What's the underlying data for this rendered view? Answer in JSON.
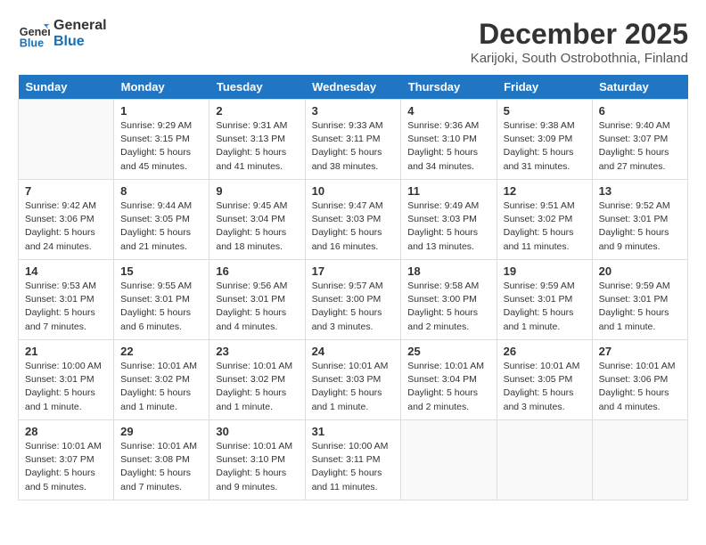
{
  "header": {
    "logo_line1": "General",
    "logo_line2": "Blue",
    "month": "December 2025",
    "location": "Karijoki, South Ostrobothnia, Finland"
  },
  "weekdays": [
    "Sunday",
    "Monday",
    "Tuesday",
    "Wednesday",
    "Thursday",
    "Friday",
    "Saturday"
  ],
  "weeks": [
    [
      {
        "day": "",
        "empty": true
      },
      {
        "day": "1",
        "sunrise": "9:29 AM",
        "sunset": "3:15 PM",
        "daylight": "5 hours and 45 minutes."
      },
      {
        "day": "2",
        "sunrise": "9:31 AM",
        "sunset": "3:13 PM",
        "daylight": "5 hours and 41 minutes."
      },
      {
        "day": "3",
        "sunrise": "9:33 AM",
        "sunset": "3:11 PM",
        "daylight": "5 hours and 38 minutes."
      },
      {
        "day": "4",
        "sunrise": "9:36 AM",
        "sunset": "3:10 PM",
        "daylight": "5 hours and 34 minutes."
      },
      {
        "day": "5",
        "sunrise": "9:38 AM",
        "sunset": "3:09 PM",
        "daylight": "5 hours and 31 minutes."
      },
      {
        "day": "6",
        "sunrise": "9:40 AM",
        "sunset": "3:07 PM",
        "daylight": "5 hours and 27 minutes."
      }
    ],
    [
      {
        "day": "7",
        "sunrise": "9:42 AM",
        "sunset": "3:06 PM",
        "daylight": "5 hours and 24 minutes."
      },
      {
        "day": "8",
        "sunrise": "9:44 AM",
        "sunset": "3:05 PM",
        "daylight": "5 hours and 21 minutes."
      },
      {
        "day": "9",
        "sunrise": "9:45 AM",
        "sunset": "3:04 PM",
        "daylight": "5 hours and 18 minutes."
      },
      {
        "day": "10",
        "sunrise": "9:47 AM",
        "sunset": "3:03 PM",
        "daylight": "5 hours and 16 minutes."
      },
      {
        "day": "11",
        "sunrise": "9:49 AM",
        "sunset": "3:03 PM",
        "daylight": "5 hours and 13 minutes."
      },
      {
        "day": "12",
        "sunrise": "9:51 AM",
        "sunset": "3:02 PM",
        "daylight": "5 hours and 11 minutes."
      },
      {
        "day": "13",
        "sunrise": "9:52 AM",
        "sunset": "3:01 PM",
        "daylight": "5 hours and 9 minutes."
      }
    ],
    [
      {
        "day": "14",
        "sunrise": "9:53 AM",
        "sunset": "3:01 PM",
        "daylight": "5 hours and 7 minutes."
      },
      {
        "day": "15",
        "sunrise": "9:55 AM",
        "sunset": "3:01 PM",
        "daylight": "5 hours and 6 minutes."
      },
      {
        "day": "16",
        "sunrise": "9:56 AM",
        "sunset": "3:01 PM",
        "daylight": "5 hours and 4 minutes."
      },
      {
        "day": "17",
        "sunrise": "9:57 AM",
        "sunset": "3:00 PM",
        "daylight": "5 hours and 3 minutes."
      },
      {
        "day": "18",
        "sunrise": "9:58 AM",
        "sunset": "3:00 PM",
        "daylight": "5 hours and 2 minutes."
      },
      {
        "day": "19",
        "sunrise": "9:59 AM",
        "sunset": "3:01 PM",
        "daylight": "5 hours and 1 minute."
      },
      {
        "day": "20",
        "sunrise": "9:59 AM",
        "sunset": "3:01 PM",
        "daylight": "5 hours and 1 minute."
      }
    ],
    [
      {
        "day": "21",
        "sunrise": "10:00 AM",
        "sunset": "3:01 PM",
        "daylight": "5 hours and 1 minute."
      },
      {
        "day": "22",
        "sunrise": "10:01 AM",
        "sunset": "3:02 PM",
        "daylight": "5 hours and 1 minute."
      },
      {
        "day": "23",
        "sunrise": "10:01 AM",
        "sunset": "3:02 PM",
        "daylight": "5 hours and 1 minute."
      },
      {
        "day": "24",
        "sunrise": "10:01 AM",
        "sunset": "3:03 PM",
        "daylight": "5 hours and 1 minute."
      },
      {
        "day": "25",
        "sunrise": "10:01 AM",
        "sunset": "3:04 PM",
        "daylight": "5 hours and 2 minutes."
      },
      {
        "day": "26",
        "sunrise": "10:01 AM",
        "sunset": "3:05 PM",
        "daylight": "5 hours and 3 minutes."
      },
      {
        "day": "27",
        "sunrise": "10:01 AM",
        "sunset": "3:06 PM",
        "daylight": "5 hours and 4 minutes."
      }
    ],
    [
      {
        "day": "28",
        "sunrise": "10:01 AM",
        "sunset": "3:07 PM",
        "daylight": "5 hours and 5 minutes."
      },
      {
        "day": "29",
        "sunrise": "10:01 AM",
        "sunset": "3:08 PM",
        "daylight": "5 hours and 7 minutes."
      },
      {
        "day": "30",
        "sunrise": "10:01 AM",
        "sunset": "3:10 PM",
        "daylight": "5 hours and 9 minutes."
      },
      {
        "day": "31",
        "sunrise": "10:00 AM",
        "sunset": "3:11 PM",
        "daylight": "5 hours and 11 minutes."
      },
      {
        "day": "",
        "empty": true
      },
      {
        "day": "",
        "empty": true
      },
      {
        "day": "",
        "empty": true
      }
    ]
  ],
  "labels": {
    "sunrise": "Sunrise:",
    "sunset": "Sunset:",
    "daylight": "Daylight:"
  }
}
